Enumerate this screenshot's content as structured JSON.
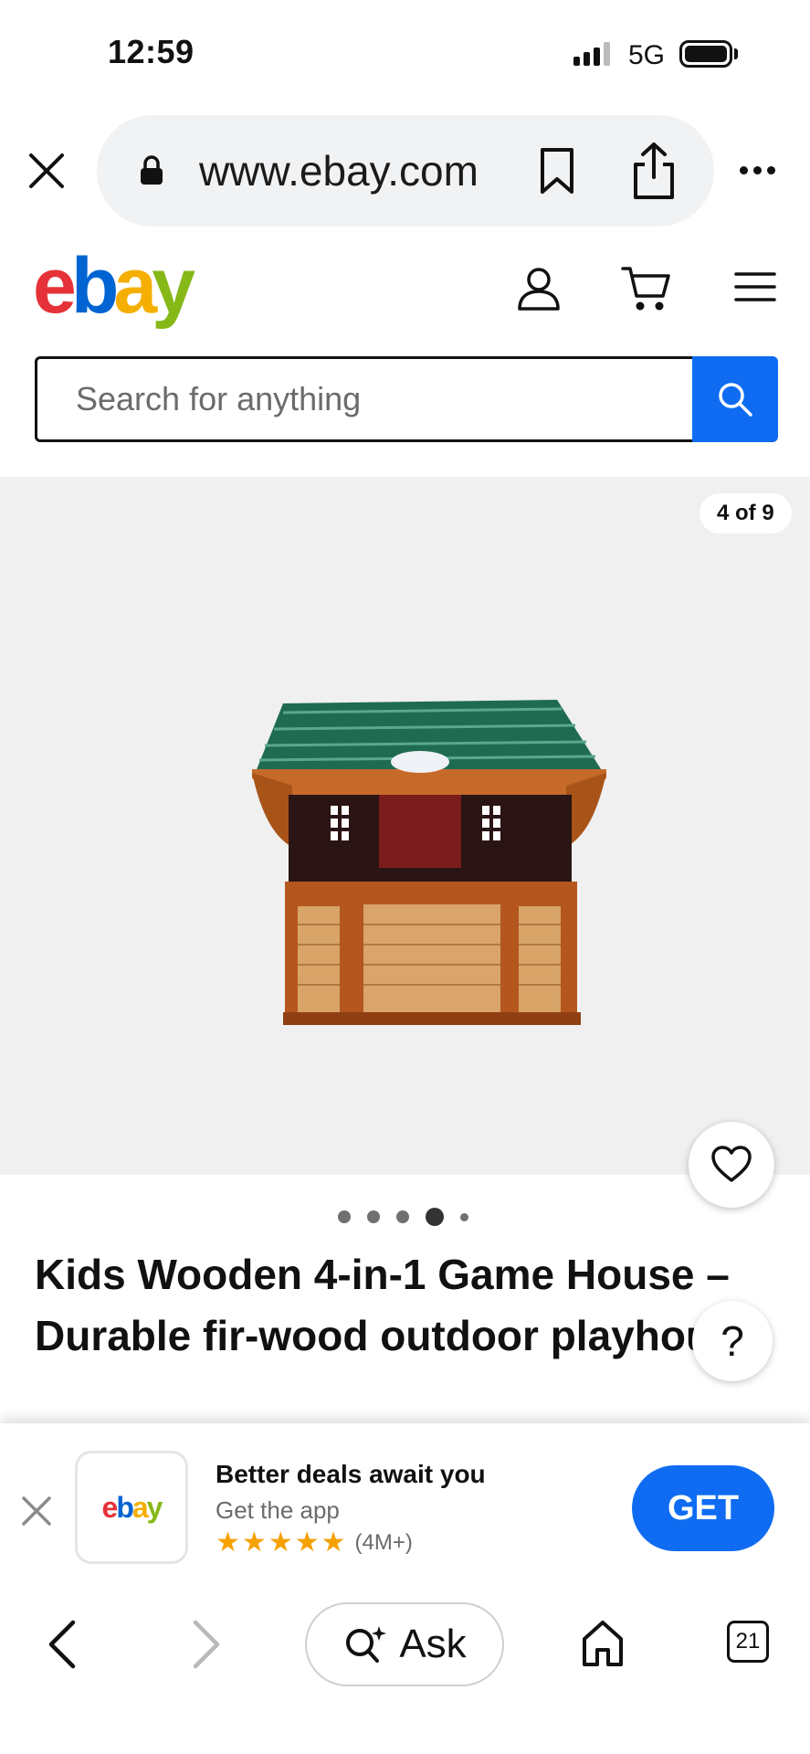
{
  "status_bar": {
    "time": "12:59",
    "network": "5G"
  },
  "browser": {
    "url": "www.ebay.com"
  },
  "header": {
    "logo": {
      "e": "e",
      "b": "b",
      "a": "a",
      "y": "y"
    },
    "icons": [
      "user-icon",
      "cart-icon",
      "menu-icon"
    ]
  },
  "search": {
    "placeholder": "Search for anything"
  },
  "gallery": {
    "counter": "4 of 9",
    "current_index": 4,
    "total": 9
  },
  "product": {
    "title": "Kids Wooden 4-in-1 Game House – Durable fir-wood outdoor playhouse",
    "help": "?"
  },
  "app_banner": {
    "title": "Better deals await you",
    "subtitle": "Get the app",
    "rating_count": "(4M+)",
    "stars": 5,
    "get_label": "GET"
  },
  "bottom_nav": {
    "ask_label": "Ask",
    "tab_count": "21"
  },
  "colors": {
    "brand_blue": "#0f6cf2",
    "ebay_red": "#e53238",
    "ebay_blue": "#0064d2",
    "ebay_yellow": "#f5af02",
    "ebay_green": "#86b817",
    "star": "#f5a100"
  }
}
